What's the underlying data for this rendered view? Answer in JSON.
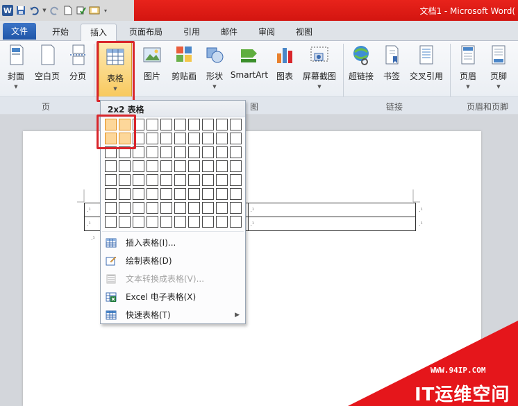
{
  "window": {
    "title": "文档1 - Microsoft Word(",
    "app_icon": "W"
  },
  "quick_access": [
    "save-icon",
    "undo-icon",
    "redo-icon",
    "new-doc-icon",
    "screenshot-icon",
    "customize-icon"
  ],
  "tabs": [
    {
      "label": "文件"
    },
    {
      "label": "开始"
    },
    {
      "label": "插入"
    },
    {
      "label": "页面布局"
    },
    {
      "label": "引用"
    },
    {
      "label": "邮件"
    },
    {
      "label": "审阅"
    },
    {
      "label": "视图"
    }
  ],
  "ribbon": {
    "buttons": [
      {
        "label": "封面",
        "icon": "cover-page-icon"
      },
      {
        "label": "空白页",
        "icon": "blank-page-icon"
      },
      {
        "label": "分页",
        "icon": "page-break-icon"
      },
      {
        "label": "表格",
        "icon": "table-icon"
      },
      {
        "label": "图片",
        "icon": "picture-icon"
      },
      {
        "label": "剪贴画",
        "icon": "clip-art-icon"
      },
      {
        "label": "形状",
        "icon": "shapes-icon"
      },
      {
        "label": "SmartArt",
        "icon": "smartart-icon"
      },
      {
        "label": "图表",
        "icon": "chart-icon"
      },
      {
        "label": "屏幕截图",
        "icon": "screenshot-icon"
      },
      {
        "label": "超链接",
        "icon": "hyperlink-icon"
      },
      {
        "label": "书签",
        "icon": "bookmark-icon"
      },
      {
        "label": "交叉引用",
        "icon": "cross-reference-icon"
      },
      {
        "label": "页眉",
        "icon": "header-icon"
      },
      {
        "label": "页脚",
        "icon": "footer-icon"
      }
    ],
    "groups": [
      {
        "label": "页"
      },
      {
        "label": "图"
      },
      {
        "label": "链接"
      },
      {
        "label": "页眉和页脚"
      }
    ]
  },
  "table_menu": {
    "header": "2x2 表格",
    "grid_cols": 10,
    "grid_rows": 8,
    "selected_cols": 2,
    "selected_rows": 2,
    "items": [
      {
        "label": "插入表格(I)...",
        "icon": "insert-table-icon",
        "enabled": true
      },
      {
        "label": "绘制表格(D)",
        "icon": "draw-table-icon",
        "enabled": true
      },
      {
        "label": "文本转换成表格(V)...",
        "icon": "text-to-table-icon",
        "enabled": false
      },
      {
        "label": "Excel 电子表格(X)",
        "icon": "excel-icon",
        "enabled": true
      },
      {
        "label": "快速表格(T)",
        "icon": "quick-tables-icon",
        "enabled": true,
        "submenu": true
      }
    ]
  },
  "document": {
    "cell_mark": ".¹"
  },
  "watermark": {
    "url": "WWW.94IP.COM",
    "brand": "IT运维空间"
  }
}
